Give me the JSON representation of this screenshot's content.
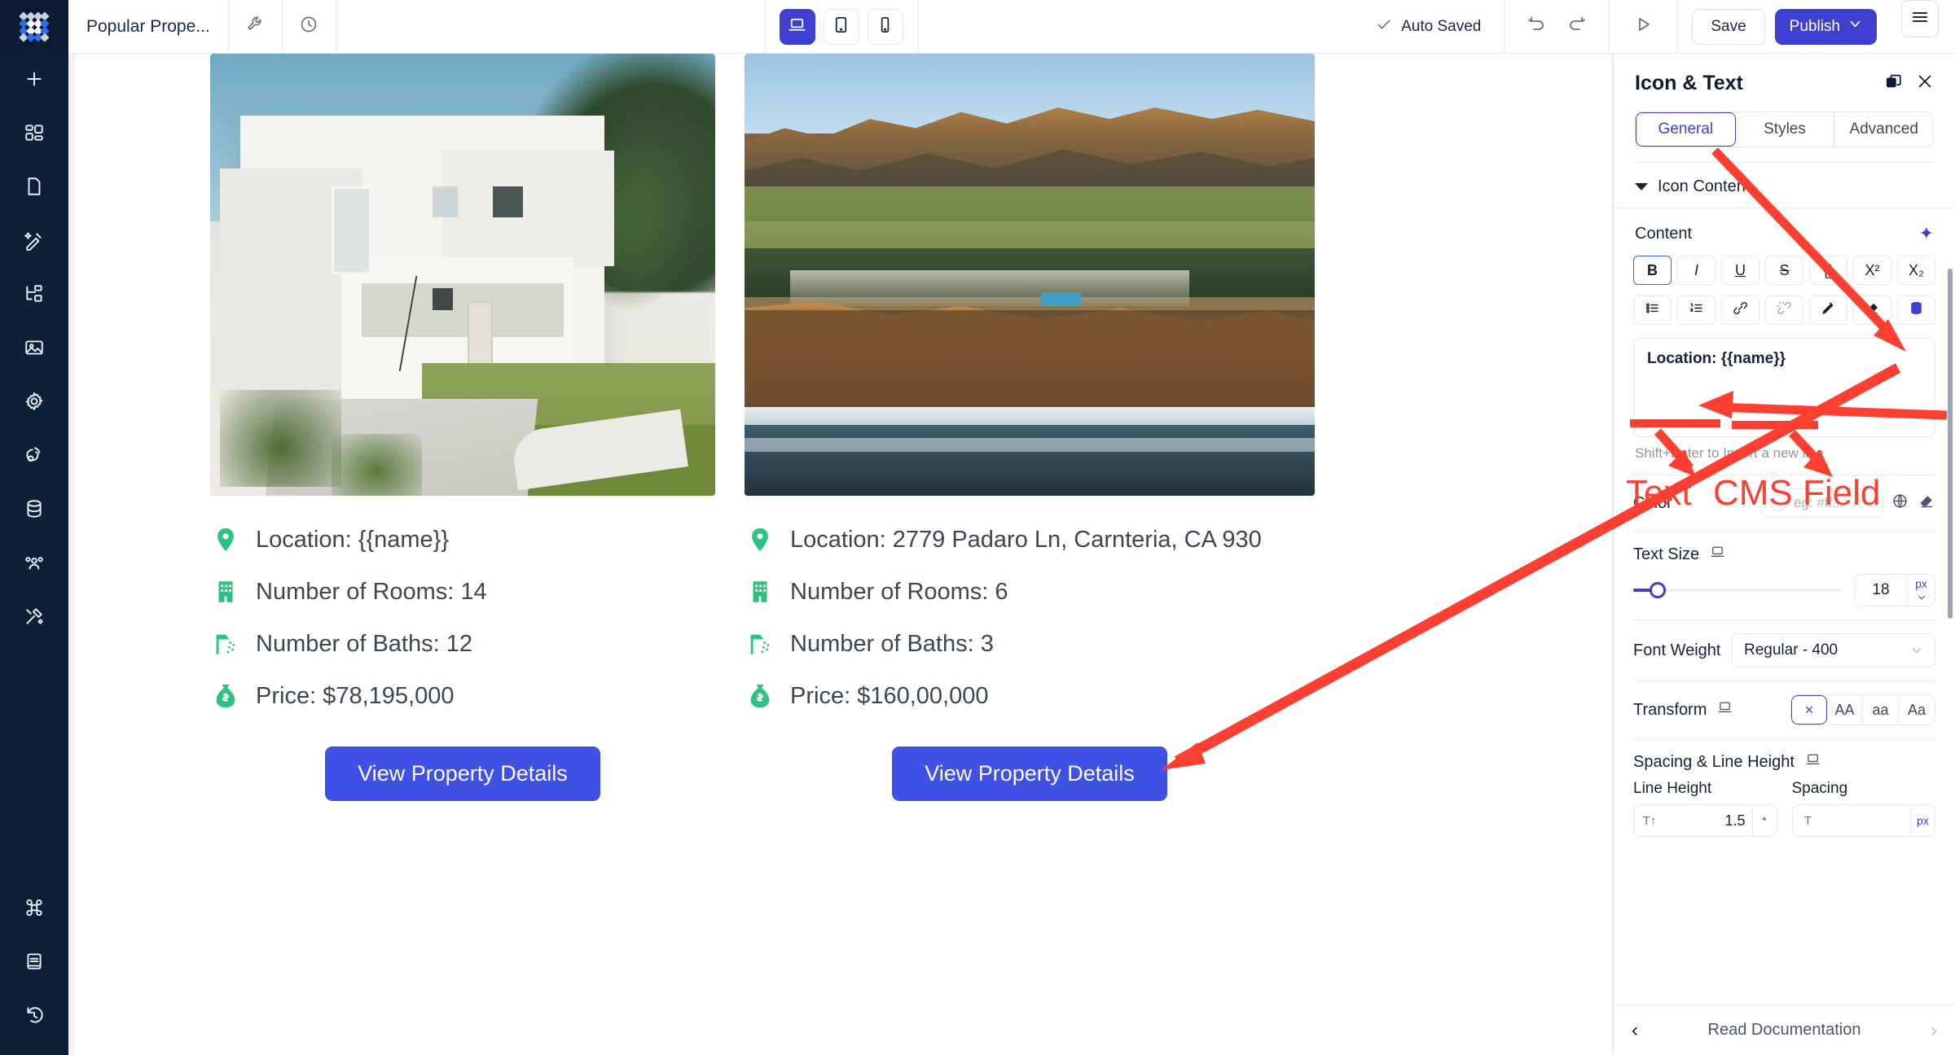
{
  "brand": {
    "accent": "#3f3fd1",
    "cta": "#4151e6",
    "icon_green": "#2ec27e",
    "annotation_red": "#fc3f31"
  },
  "topbar": {
    "page_title": "Popular Prope...",
    "wrench_icon": "wrench-icon",
    "history_icon": "clock-history-icon",
    "devices": [
      {
        "name": "desktop",
        "icon": "laptop-icon",
        "active": true
      },
      {
        "name": "tablet",
        "icon": "tablet-icon",
        "active": false
      },
      {
        "name": "mobile",
        "icon": "mobile-icon",
        "active": false
      }
    ],
    "autosave_label": "Auto Saved",
    "autosave_icon": "check-icon",
    "undo_icon": "undo-icon",
    "redo_icon": "redo-icon",
    "preview_icon": "play-icon",
    "save_label": "Save",
    "publish_label": "Publish",
    "publish_caret_icon": "chevron-down-icon",
    "menu_icon": "hamburger-icon"
  },
  "rail": {
    "logo": "app-logo",
    "items": [
      {
        "name": "add",
        "icon": "plus-icon"
      },
      {
        "name": "widgets",
        "icon": "widgets-grid-icon"
      },
      {
        "name": "pages",
        "icon": "page-icon"
      },
      {
        "name": "design",
        "icon": "magic-pen-icon"
      },
      {
        "name": "layers",
        "icon": "layers-tree-icon"
      },
      {
        "name": "media",
        "icon": "image-icon"
      },
      {
        "name": "settings",
        "icon": "gear-icon"
      },
      {
        "name": "publish-status",
        "icon": "broadcast-icon"
      },
      {
        "name": "database",
        "icon": "database-icon"
      },
      {
        "name": "users",
        "icon": "users-icon"
      },
      {
        "name": "tools",
        "icon": "tools-icon"
      }
    ],
    "bottom_items": [
      {
        "name": "shortcuts",
        "icon": "command-icon"
      },
      {
        "name": "docs",
        "icon": "book-icon"
      },
      {
        "name": "revisions",
        "icon": "revision-clock-icon"
      }
    ]
  },
  "canvas": {
    "properties": [
      {
        "image_alt": "white-modernist-villa-photo",
        "rows": [
          {
            "icon": "location-pin-icon",
            "text": "Location: {{name}}"
          },
          {
            "icon": "building-icon",
            "text": "Number of Rooms: 14"
          },
          {
            "icon": "shower-icon",
            "text": "Number of Baths: 12"
          },
          {
            "icon": "money-bag-icon",
            "text": "Price: $78,195,000"
          }
        ],
        "cta": "View Property Details"
      },
      {
        "image_alt": "coastal-cliff-golden-hour-photo",
        "rows": [
          {
            "icon": "location-pin-icon",
            "text": "Location: 2779 Padaro Ln, Carnteria, CA 930"
          },
          {
            "icon": "building-icon",
            "text": "Number of Rooms: 6"
          },
          {
            "icon": "shower-icon",
            "text": "Number of Baths: 3"
          },
          {
            "icon": "money-bag-icon",
            "text": "Price: $160,00,000"
          }
        ],
        "cta": "View Property Details"
      }
    ]
  },
  "panel": {
    "title": "Icon & Text",
    "duplicate_icon": "duplicate-icon",
    "close_icon": "close-icon",
    "tabs": [
      {
        "label": "General",
        "active": true
      },
      {
        "label": "Styles",
        "active": false
      },
      {
        "label": "Advanced",
        "active": false
      }
    ],
    "section": {
      "label": "Icon Content",
      "collapse_icon": "caret-down-icon"
    },
    "content": {
      "label": "Content",
      "ai_icon": "sparkle-ai-icon",
      "format_row_1": [
        {
          "name": "bold",
          "glyph": "B",
          "active": true
        },
        {
          "name": "italic",
          "glyph": "I",
          "active": false
        },
        {
          "name": "underline",
          "glyph": "U",
          "active": false
        },
        {
          "name": "strikethrough",
          "glyph": "S",
          "active": false
        },
        {
          "name": "code",
          "glyph": "{}",
          "active": false
        },
        {
          "name": "superscript",
          "glyph": "X²",
          "active": false
        },
        {
          "name": "subscript",
          "glyph": "X₂",
          "active": false
        }
      ],
      "format_row_2": [
        {
          "name": "bullet-list",
          "icon": "bullet-list-icon"
        },
        {
          "name": "numbered-list",
          "icon": "numbered-list-icon"
        },
        {
          "name": "link",
          "icon": "link-icon"
        },
        {
          "name": "unlink",
          "icon": "unlink-icon"
        },
        {
          "name": "highlighter",
          "icon": "marker-pen-icon"
        },
        {
          "name": "clear-format",
          "icon": "eraser-icon"
        },
        {
          "name": "cms-field",
          "icon": "database-icon"
        }
      ],
      "editor_value": "Location: {{name}}",
      "hint": "Shift+Enter to Insert a new line"
    },
    "color": {
      "label": "Color",
      "placeholder": "eg: #ff...",
      "global_icon": "globe-icon",
      "clear_icon": "eraser-icon"
    },
    "text_size": {
      "label": "Text Size",
      "device_icon": "laptop-icon",
      "value": "18",
      "unit": "px",
      "unit_caret_icon": "chevron-down-icon"
    },
    "font_weight": {
      "label": "Font Weight",
      "value": "Regular - 400",
      "caret_icon": "chevron-down-icon"
    },
    "transform": {
      "label": "Transform",
      "device_icon": "laptop-icon",
      "options": [
        {
          "label": "×",
          "name": "none",
          "active": true
        },
        {
          "label": "AA",
          "name": "uppercase",
          "active": false
        },
        {
          "label": "aa",
          "name": "lowercase",
          "active": false
        },
        {
          "label": "Aa",
          "name": "capitalize",
          "active": false
        }
      ]
    },
    "spacing": {
      "label": "Spacing & Line Height",
      "device_icon": "laptop-icon",
      "line_height": {
        "label": "Line Height",
        "icon": "line-height-icon",
        "value": "1.5",
        "unit": "*"
      },
      "letter_spacing": {
        "label": "Spacing",
        "icon": "letter-spacing-icon",
        "value": "",
        "unit": "px"
      }
    },
    "footer": {
      "prev_icon": "chevron-left-icon",
      "label": "Read Documentation",
      "next_icon": "chevron-right-icon"
    }
  },
  "annotations": [
    {
      "name": "arrow-to-general-tab",
      "label": ""
    },
    {
      "name": "arrow-to-cms-field-button",
      "label": ""
    },
    {
      "name": "arrow-to-editor-text",
      "label": ""
    },
    {
      "name": "label-text",
      "label": "Text"
    },
    {
      "name": "label-cms-field",
      "label": "CMS Field"
    },
    {
      "name": "arrow-to-canvas-location",
      "label": ""
    }
  ]
}
